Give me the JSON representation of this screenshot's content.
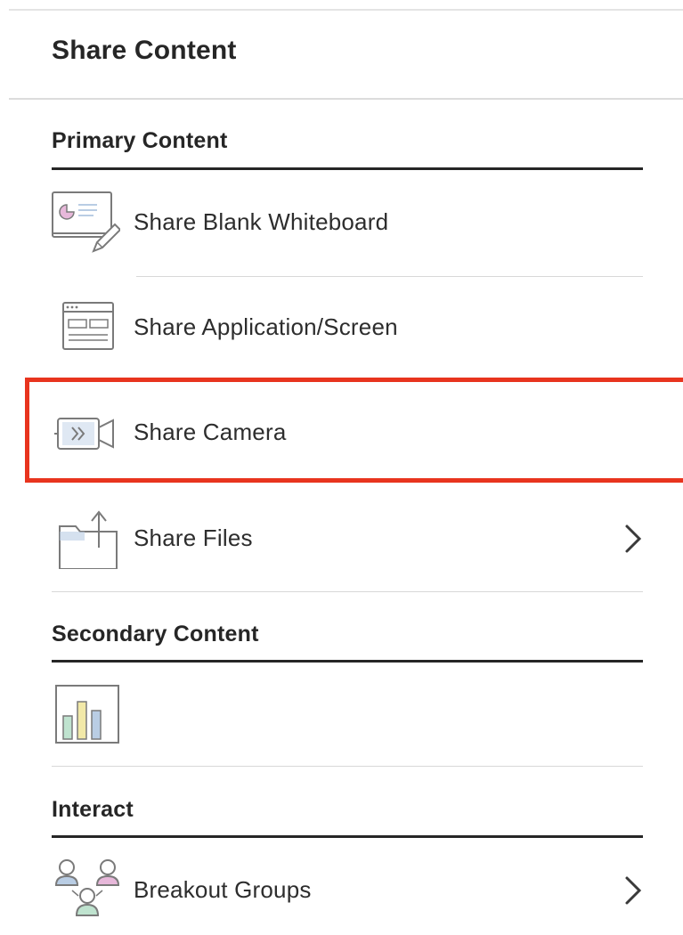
{
  "panel": {
    "title": "Share Content"
  },
  "sections": {
    "primary": {
      "heading": "Primary Content",
      "items": [
        {
          "label": "Share Blank Whiteboard",
          "icon": "whiteboard-icon",
          "has_submenu": false
        },
        {
          "label": "Share Application/Screen",
          "icon": "application-screen-icon",
          "has_submenu": false
        },
        {
          "label": "Share Camera",
          "icon": "camera-icon",
          "has_submenu": false
        },
        {
          "label": "Share Files",
          "icon": "folder-upload-icon",
          "has_submenu": true
        }
      ]
    },
    "secondary": {
      "heading": "Secondary Content",
      "items": [
        {
          "label": "",
          "icon": "polling-chart-icon",
          "has_submenu": false
        }
      ]
    },
    "interact": {
      "heading": "Interact",
      "items": [
        {
          "label": "Breakout Groups",
          "icon": "breakout-groups-icon",
          "has_submenu": true
        }
      ]
    }
  },
  "chevron_icon": "chevron-right-icon",
  "colors": {
    "highlight": "#e8341e",
    "text": "#262626",
    "icon_stroke": "#7a7a7a",
    "icon_blue": "#b9cde4",
    "icon_pink": "#e7b8da",
    "icon_green": "#bfe3cf",
    "rule": "#d8d8d8"
  }
}
